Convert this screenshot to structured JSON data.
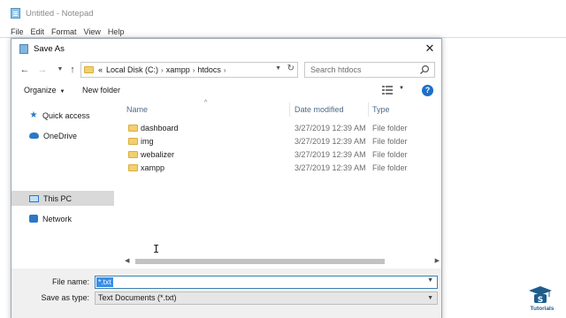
{
  "notepad": {
    "title": "Untitled - Notepad",
    "menu": [
      "File",
      "Edit",
      "Format",
      "View",
      "Help"
    ]
  },
  "dialog": {
    "title": "Save As",
    "address": {
      "prefix": "«",
      "segments": [
        "Local Disk (C:)",
        "xampp",
        "htdocs"
      ]
    },
    "search_placeholder": "Search htdocs",
    "toolbar": {
      "organize": "Organize",
      "new_folder": "New folder"
    },
    "nav": [
      {
        "label": "Quick access",
        "icon": "star-icon"
      },
      {
        "label": "OneDrive",
        "icon": "cloud-icon"
      },
      {
        "label": "This PC",
        "icon": "computer-icon",
        "selected": true
      },
      {
        "label": "Network",
        "icon": "network-icon"
      }
    ],
    "columns": {
      "name": "Name",
      "date": "Date modified",
      "type": "Type"
    },
    "files": [
      {
        "name": "dashboard",
        "date": "3/27/2019 12:39 AM",
        "type": "File folder"
      },
      {
        "name": "img",
        "date": "3/27/2019 12:39 AM",
        "type": "File folder"
      },
      {
        "name": "webalizer",
        "date": "3/27/2019 12:39 AM",
        "type": "File folder"
      },
      {
        "name": "xampp",
        "date": "3/27/2019 12:39 AM",
        "type": "File folder"
      }
    ],
    "file_name_label": "File name:",
    "file_name_value": "*.txt",
    "save_type_label": "Save as type:",
    "save_type_value": "Text Documents (*.txt)"
  },
  "watermark": {
    "text": "Tutorials"
  },
  "colors": {
    "accent": "#1c6fc6",
    "selection": "#3a8ee6",
    "folder": "#f3cf6e"
  }
}
